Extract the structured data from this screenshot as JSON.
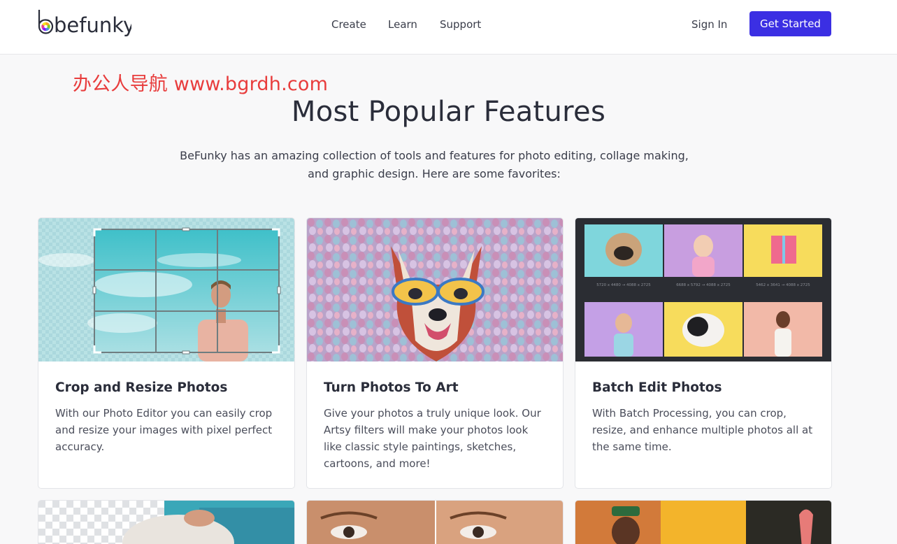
{
  "brand": {
    "logo_text": "befunky"
  },
  "nav": {
    "items": [
      "Create",
      "Learn",
      "Support"
    ],
    "sign_in": "Sign In",
    "cta": "Get Started"
  },
  "watermark": "办公人导航  www.bgrdh.com",
  "section": {
    "title": "Most Popular Features",
    "subtitle": "BeFunky has an amazing collection of tools and features for photo editing, collage making, and graphic design. Here are some favorites:"
  },
  "cards": [
    {
      "title": "Crop and Resize Photos",
      "description": "With our Photo Editor you can easily crop and resize your images with pixel perfect accuracy."
    },
    {
      "title": "Turn Photos To Art",
      "description": "Give your photos a truly unique look. Our Artsy filters will make your photos look like classic style paintings, sketches, cartoons, and more!"
    },
    {
      "title": "Batch Edit Photos",
      "description": "With Batch Processing, you can crop, resize, and enhance multiple photos all at the same time."
    }
  ],
  "batch_labels": [
    "5720 x 4480 → 4088 x 2725",
    "6688 x 5792 → 4088 x 2725",
    "5462 x 3641 → 4088 x 2725"
  ],
  "colors": {
    "accent": "#3b2fe3",
    "watermark": "#e83c3c",
    "text": "#2a2d3a",
    "background": "#f8f8f9"
  }
}
